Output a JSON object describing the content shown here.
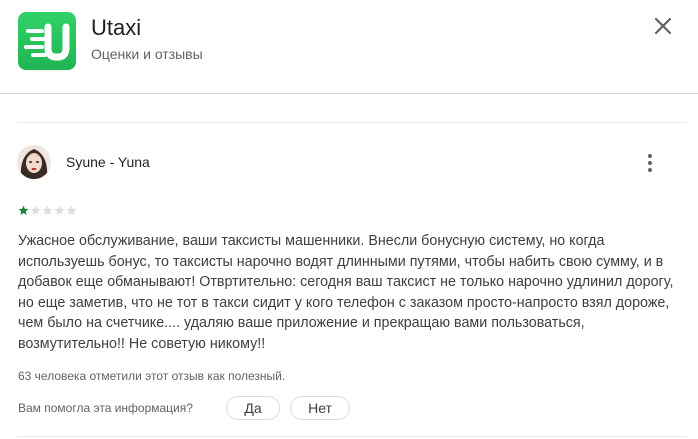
{
  "app": {
    "name": "Utaxi",
    "subtitle": "Оценки и отзывы",
    "brand_color": "#22c55e",
    "icon": "utaxi-logo"
  },
  "review": {
    "author": "Syune - Yuna",
    "rating": 1,
    "rating_max": 5,
    "star_filled_color": "#188038",
    "star_empty_color": "#dadce0",
    "text": "Ужасное обслуживание, ваши таксисты машенники. Внесли бонусную систему, но когда используешь бонус, то таксисты нарочно водят длинными путями, чтобы набить свою сумму, и в добавок еще обманывают! Отвртительно: сегодня ваш таксист не только нарочно удлинил дорогу, но еще заметив, что не тот в такси сидит у кого телефон с заказом просто-напросто взял дороже, чем было на счетчике.... удаляю ваше приложение и прекращаю вами пользоваться, возмутительно!! Не советую никому!!",
    "helpful_count_text": "63 человека отметили этот отзыв как полезный.",
    "helpful_question": "Вам помогла эта информация?",
    "yes_label": "Да",
    "no_label": "Нет"
  },
  "icons": {
    "close": "close-icon",
    "more": "more-vertical-icon"
  }
}
